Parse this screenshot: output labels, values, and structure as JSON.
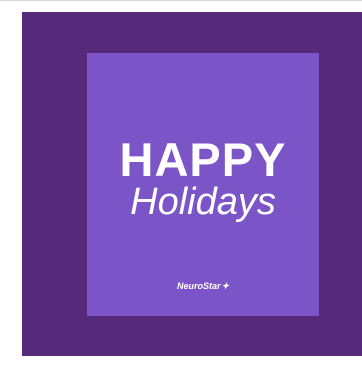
{
  "card": {
    "headline": "HAPPY",
    "subheadline": "Holidays",
    "logo_text": "NeuroStar",
    "logo_icon": "star-icon"
  },
  "colors": {
    "outer_background": "#57297b",
    "card_background": "#7b55c8",
    "text": "#ffffff"
  }
}
